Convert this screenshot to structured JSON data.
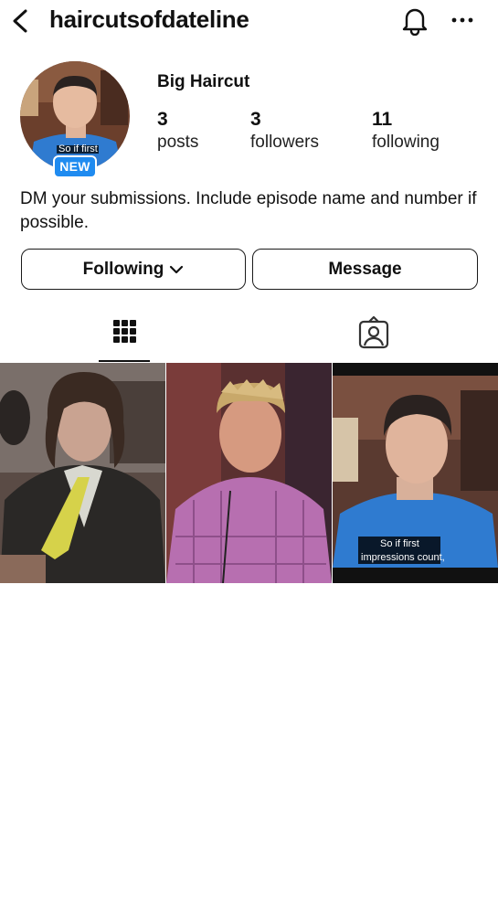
{
  "header": {
    "username": "haircutsofdateline",
    "icons": [
      "back-arrow-icon",
      "bell-icon",
      "more-icon"
    ]
  },
  "profile": {
    "display_name": "Big Haircut",
    "badge": "NEW",
    "avatar_caption": "So if first",
    "stats": {
      "posts": {
        "count": "3",
        "label": "posts"
      },
      "followers": {
        "count": "3",
        "label": "followers"
      },
      "following": {
        "count": "11",
        "label": "following"
      }
    },
    "bio": "DM your submissions. Include episode name and number if possible."
  },
  "actions": {
    "following_label": "Following",
    "message_label": "Message"
  },
  "tabs": [
    {
      "name": "grid",
      "icon": "grid-icon",
      "active": true
    },
    {
      "name": "tagged",
      "icon": "tagged-person-icon",
      "active": false
    }
  ],
  "posts": [
    {
      "icon": "photo-man-suit-yellow-tie"
    },
    {
      "icon": "photo-man-spiky-hair"
    },
    {
      "icon": "photo-man-blue-polo",
      "subtitle_line1": "So if first",
      "subtitle_line2": "impressions count,"
    }
  ],
  "colors": {
    "badge": "#1f8bf0",
    "text": "#111111",
    "border": "#1a1a1a",
    "background": "#ffffff"
  }
}
